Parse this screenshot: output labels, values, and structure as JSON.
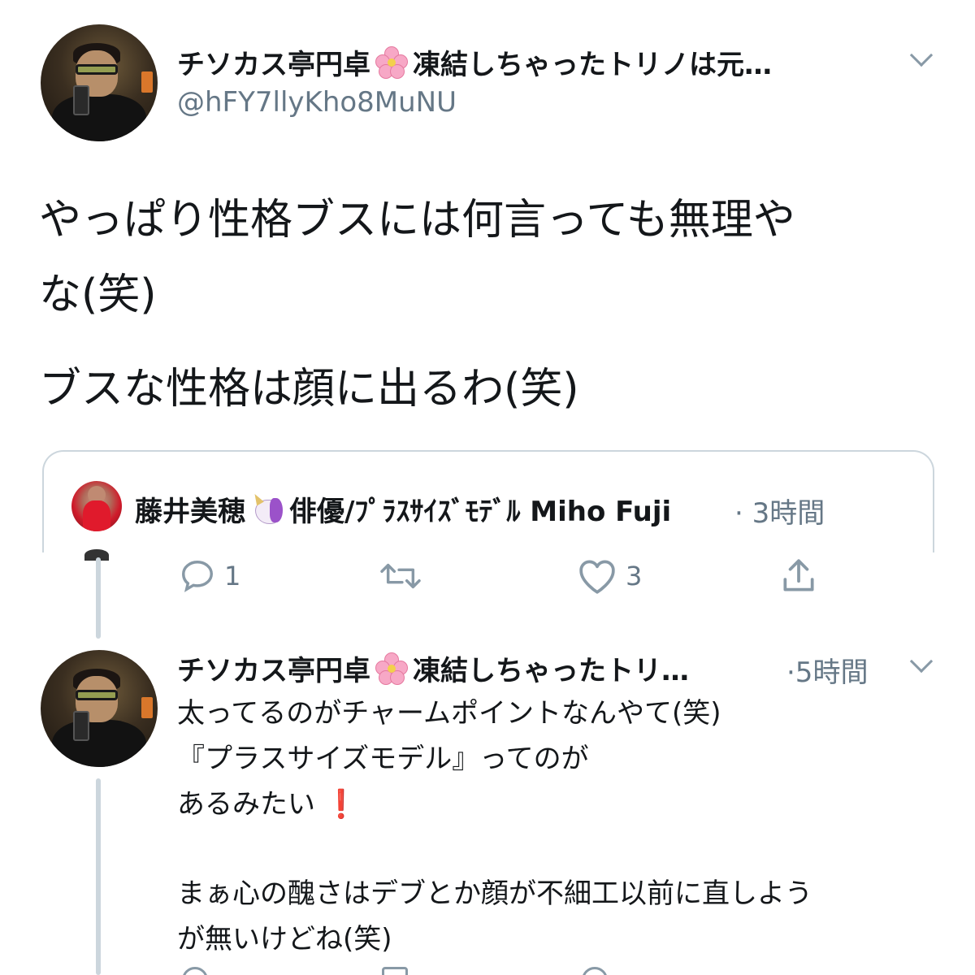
{
  "main_tweet": {
    "display_name": "チソカス亭円卓",
    "display_name_suffix": "凍結しちゃったトリノは元…",
    "name_emoji": "cherry-blossom-emoji",
    "handle": "@hFY7llyKho8MuNU",
    "text_line1": "やっぱり性格ブスには何言っても無理や",
    "text_line2": "な(笑)",
    "text_line3": "ブスな性格は顔に出るわ(笑)"
  },
  "quoted_tweet": {
    "display_name": "藤井美穂",
    "name_emoji": "unicorn-emoji",
    "display_name_suffix": "俳優/ﾌﾟﾗｽｻｲｽﾞﾓﾃﾞﾙ Miho Fuji",
    "time": "· 3時間"
  },
  "actions": {
    "reply_count": "1",
    "retweet_count": "",
    "like_count": "3"
  },
  "reply_tweet": {
    "display_name": "チソカス亭円卓",
    "display_name_suffix": "凍結しちゃったトリ…",
    "name_emoji": "cherry-blossom-emoji",
    "time": "·5時間",
    "line1": "太ってるのがチャームポイントなんやて(笑)",
    "line2": "『プラスサイズモデル』ってのが",
    "line3": "あるみたい",
    "line3_emoji": "❗",
    "line4": "まぁ心の醜さはデブとか顔が不細工以前に直しよう",
    "line5": "が無いけどね(笑)"
  },
  "colors": {
    "text": "#14171a",
    "secondary": "#657786",
    "border": "#ccd6dd",
    "accent_red": "#e0162b"
  }
}
